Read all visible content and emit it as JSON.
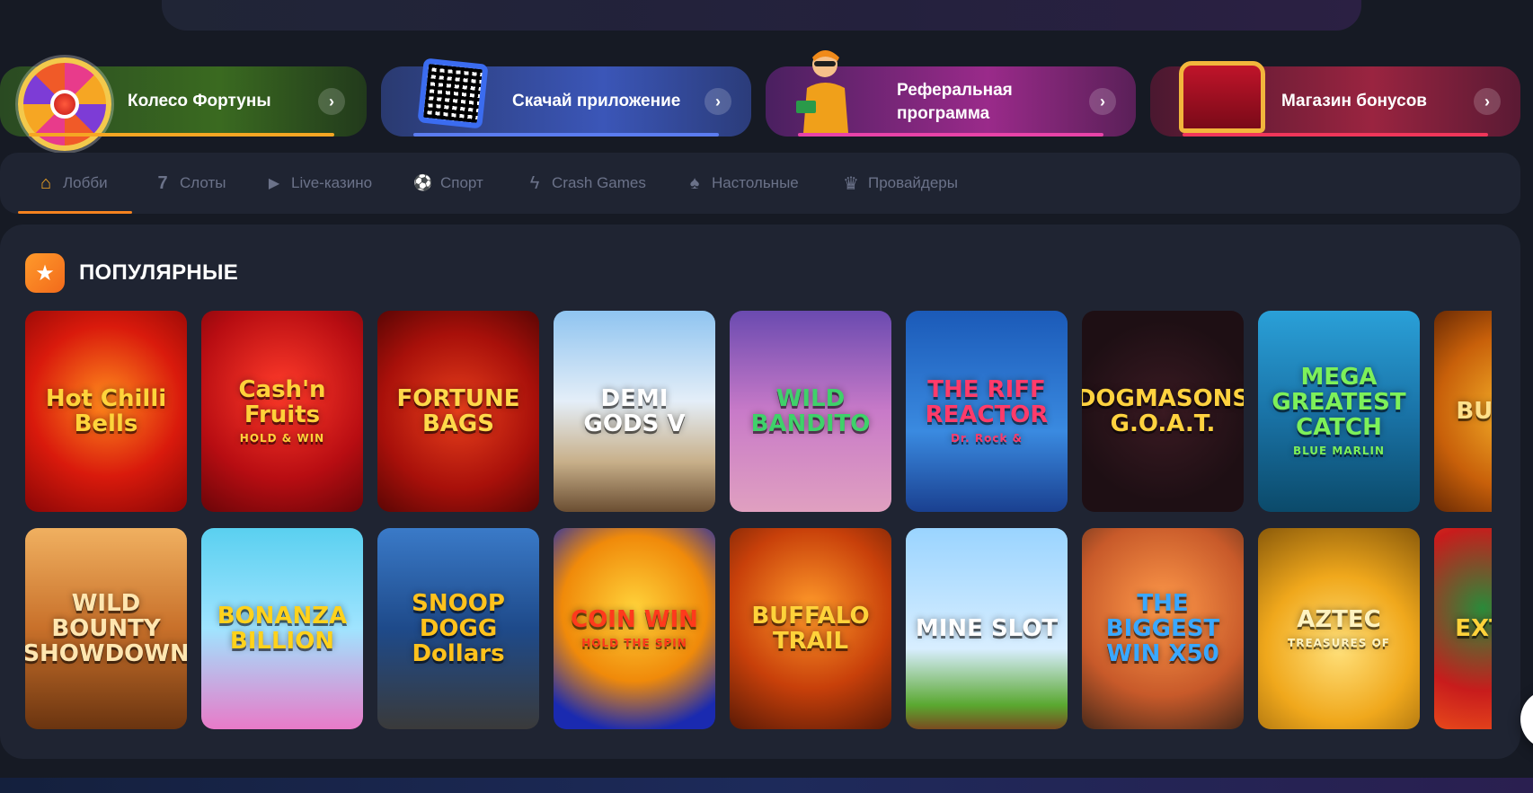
{
  "promos": [
    {
      "label": "Колесо Фортуны",
      "bg": "linear-gradient(90deg,#2a4a22,#3a6a20 60%,#223a1c)",
      "bar": "#f5a623"
    },
    {
      "label": "Скачай приложение",
      "bg": "linear-gradient(90deg,#2a3a70,#3b56b8 60%,#2b3c7a)",
      "bar": "#5b7cf0"
    },
    {
      "label": "Реферальная программа",
      "bg": "linear-gradient(90deg,#4a2060,#9a2a8a 60%,#5a2058)",
      "bar": "#e843a8"
    },
    {
      "label": "Магазин бонусов",
      "bg": "linear-gradient(90deg,#4a1830,#9a2440 60%,#5a1a34)",
      "bar": "#f0365a"
    }
  ],
  "nav": {
    "tabs": [
      {
        "label": "Лобби",
        "icon": "home-icon",
        "glyph": "⌂",
        "active": true
      },
      {
        "label": "Слоты",
        "icon": "seven-icon",
        "glyph": "7",
        "active": false
      },
      {
        "label": "Live-казино",
        "icon": "play-icon",
        "glyph": "▶",
        "active": false
      },
      {
        "label": "Спорт",
        "icon": "sport-icon",
        "glyph": "⚽",
        "active": false
      },
      {
        "label": "Crash Games",
        "icon": "lightning-icon",
        "glyph": "ϟ",
        "active": false
      },
      {
        "label": "Настольные",
        "icon": "spade-icon",
        "glyph": "♠",
        "active": false
      },
      {
        "label": "Провайдеры",
        "icon": "crown-icon",
        "glyph": "♛",
        "active": false
      }
    ]
  },
  "popular": {
    "title": "ПОПУЛЯРНЫЕ",
    "games": [
      {
        "name": "Hot Chilli Bells",
        "sub": "",
        "bg": "radial-gradient(circle at 50% 45%,#ff8a1c,#d91a0c 55%,#8a0606)",
        "color": "#ffd43b"
      },
      {
        "name": "Cash'n Fruits",
        "sub": "HOLD & WIN",
        "bg": "radial-gradient(circle at 50% 40%,#ff3b2a,#b80d12 60%,#6a0508)",
        "color": "#ffd13a"
      },
      {
        "name": "FORTUNE BAGS",
        "sub": "",
        "bg": "radial-gradient(circle at 50% 50%,#e8401c,#a8100a 60%,#5a0604)",
        "color": "#ffd94a"
      },
      {
        "name": "DEMI GODS V",
        "sub": "",
        "bg": "linear-gradient(180deg,#8fc4f0,#e4eef8 45%,#c8b08a 75%,#6b4e32)",
        "color": "#ffffff"
      },
      {
        "name": "WILD BANDITO",
        "sub": "",
        "bg": "linear-gradient(180deg,#6a4ab0,#c87ac8 50%,#e0a0c0)",
        "color": "#3fd16a"
      },
      {
        "name": "THE RIFF REACTOR",
        "sub": "Dr. Rock &",
        "bg": "linear-gradient(180deg,#1b5ab8,#3a8ae0 60%,#1a4090)",
        "color": "#ff3b6a"
      },
      {
        "name": "DOGMASONS G.O.A.T.",
        "sub": "",
        "bg": "radial-gradient(circle at 50% 50%,#3a1a22,#1e0f14 70%)",
        "color": "#ffd23f"
      },
      {
        "name": "MEGA GREATEST CATCH",
        "sub": "BLUE MARLIN",
        "bg": "linear-gradient(180deg,#2aa0d8,#1a74a8 50%,#0b4a6a)",
        "color": "#7df05a"
      },
      {
        "name": "BUFFALO",
        "sub": "",
        "bg": "radial-gradient(circle at 50% 50%,#f6b32a,#c8600a 60%,#6a2a04)",
        "color": "#ffe08a"
      },
      {
        "name": "WILD BOUNTY SHOWDOWN",
        "sub": "",
        "bg": "linear-gradient(180deg,#f0b060,#c8702a 50%,#6a3410)",
        "color": "#ffe6b0"
      },
      {
        "name": "BONANZA BILLION",
        "sub": "",
        "bg": "linear-gradient(180deg,#5ad0f0,#a0e4ff 50%,#e87ac8)",
        "color": "#ffd21c"
      },
      {
        "name": "SNOOP DOGG Dollars",
        "sub": "",
        "bg": "linear-gradient(180deg,#3a7ac8,#1e4a8a 50%,#3a3a3a)",
        "color": "#ffc21c"
      },
      {
        "name": "COIN WIN",
        "sub": "HOLD THE SPIN",
        "bg": "radial-gradient(circle at 50% 40%,#ffd23a,#f08a0a 50%,#1a2ab0 85%)",
        "color": "#ff3a1c"
      },
      {
        "name": "BUFFALO TRAIL",
        "sub": "",
        "bg": "radial-gradient(circle at 50% 40%,#ff9a2a,#c8400a 55%,#5a1a06)",
        "color": "#ffd23a"
      },
      {
        "name": "MINE SLOT",
        "sub": "",
        "bg": "linear-gradient(180deg,#9ad4ff,#d8eeff 60%,#5aa830 88%,#7a4a20)",
        "color": "#ffffff"
      },
      {
        "name": "THE BIGGEST WIN X50",
        "sub": "",
        "bg": "radial-gradient(circle at 50% 40%,#ff9a4a,#c85a2a 60%,#4a2a1a)",
        "color": "#3aa8ff"
      },
      {
        "name": "AZTEC",
        "sub": "TREASURES OF",
        "bg": "radial-gradient(circle at 50% 60%,#ffe07a,#f0a81c 50%,#8a5a0a)",
        "color": "#fff3c0"
      },
      {
        "name": "EXTRA W",
        "sub": "",
        "bg": "radial-gradient(circle at 30% 40%,#2a8a3a,#c81c1c 50%,#ff6a1a)",
        "color": "#ffd23a"
      }
    ]
  }
}
